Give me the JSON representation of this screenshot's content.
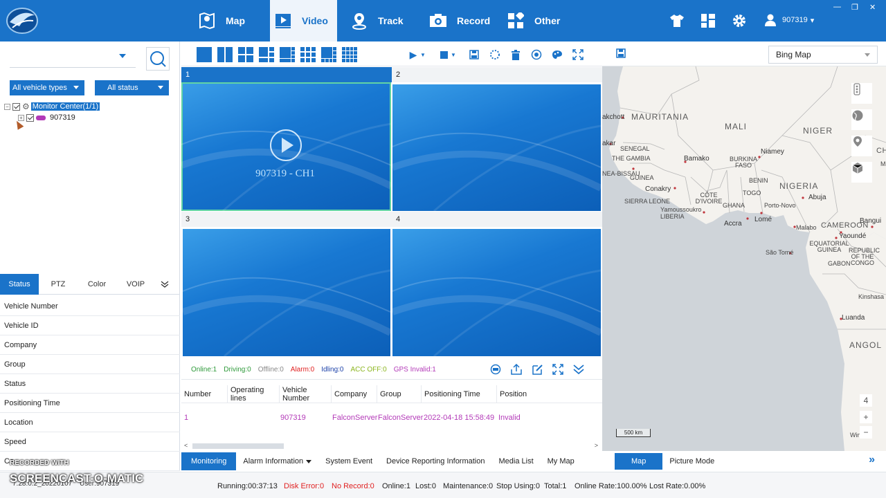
{
  "nav": {
    "tabs": [
      {
        "label": "Map",
        "icon": "map-pin-icon"
      },
      {
        "label": "Video",
        "icon": "video-play-icon"
      },
      {
        "label": "Track",
        "icon": "location-track-icon"
      },
      {
        "label": "Record",
        "icon": "camera-record-icon"
      },
      {
        "label": "Other",
        "icon": "grid-apps-icon"
      }
    ],
    "active": "Video",
    "user": "907319"
  },
  "left": {
    "search_value": "",
    "filters": {
      "vehicle_types": "All vehicle types",
      "status": "All status"
    },
    "tree": {
      "root": "Monitor Center(1/1)",
      "child": "907319"
    },
    "tabs": [
      "Status",
      "PTZ",
      "Color",
      "VOIP"
    ],
    "active_tab": "Status",
    "fields": [
      "Vehicle Number",
      "Vehicle ID",
      "Company",
      "Group",
      "Status",
      "Positioning Time",
      "Location",
      "Speed",
      "Co"
    ]
  },
  "video": {
    "cells": [
      {
        "num": "1",
        "label": "907319 - CH1"
      },
      {
        "num": "2",
        "label": ""
      },
      {
        "num": "3",
        "label": ""
      },
      {
        "num": "4",
        "label": ""
      }
    ],
    "status": {
      "online": "Online:1",
      "driving": "Driving:0",
      "offline": "Offline:0",
      "alarm": "Alarm:0",
      "idling": "Idling:0",
      "acc_off": "ACC OFF:0",
      "gps_invalid": "GPS Invalid:1"
    },
    "colors": {
      "online": "#2e9a3a",
      "driving": "#2e9a3a",
      "offline": "#888888",
      "alarm": "#e02020",
      "idling": "#1a3fa8",
      "acc_off": "#8bb51e",
      "gps_invalid": "#b33ab8"
    }
  },
  "table": {
    "headers": [
      "Number",
      "Operating lines",
      "Vehicle Number",
      "Company",
      "Group",
      "Positioning Time",
      "Position"
    ],
    "rows": [
      [
        "1",
        "",
        "907319",
        "FalconServer",
        "FalconServer",
        "2022-04-18 15:58:49",
        "Invalid"
      ]
    ]
  },
  "bottom_tabs": [
    "Monitoring",
    "Alarm Information",
    "System Event",
    "Device Reporting Information",
    "Media List",
    "My Map"
  ],
  "bottom_active": "Monitoring",
  "map": {
    "provider": "Bing Map",
    "labels": {
      "mauritania": "MAURITANIA",
      "mali": "MALI",
      "niger": "NIGER",
      "nigeria": "NIGERIA",
      "cameroon": "CAMEROON",
      "gabon": "GABON",
      "angola": "ANGOL",
      "guinea": "GUINEA",
      "senegal": "SENEGAL",
      "gambia": "THE GAMBIA",
      "guinea_bissau": "NEA-BISSAU",
      "sierra_leone": "SIERRA LEONE",
      "liberia": "LIBERIA",
      "cote": "CÔTE D'IVOIRE",
      "ghana": "GHANA",
      "togo": "TOGO",
      "benin": "BENIN",
      "burkina": "BURKINA FASO",
      "eq_guinea": "EQUATORIAL GUINEA",
      "congo": "REPUBLIC OF THE CONGO",
      "cha": "CHA",
      "ame": "ME",
      "bamako": "Bamako",
      "niamey": "Niamey",
      "abuja": "Abuja",
      "conakry": "Conakry",
      "yamoussoukro": "Yamoussoukro",
      "accra": "Accra",
      "lome": "Lomé",
      "porto_novo": "Porto-Novo",
      "malabo": "Malabo",
      "yaounde": "Yaoundé",
      "bangui": "Bangui",
      "sao_tome": "São Tomé",
      "kinshasa": "Kinshasa",
      "luanda": "Luanda",
      "nouakchott": "akchott",
      "dakar": "akar",
      "windh": "Windh"
    },
    "zoom": "4",
    "scale": "500 km",
    "modes": [
      "Map",
      "Picture Mode"
    ],
    "active_mode": "Map"
  },
  "statusbar": {
    "running": "Running:00:37:13",
    "disk_error": "Disk Error:0",
    "no_record": "No Record:0",
    "online": "Online:1",
    "lost": "Lost:0",
    "maintenance": "Maintenance:0",
    "stop_using": "Stop Using:0",
    "total": "Total:1",
    "online_rate": "Online Rate:100.00%",
    "lost_rate": "Lost Rate:0.00%",
    "version": "7.28.0.2_20220107",
    "user": "User:907319"
  },
  "watermark": {
    "line1": "RECORDED WITH",
    "line2": "SCREENCAST-O-MATIC"
  }
}
